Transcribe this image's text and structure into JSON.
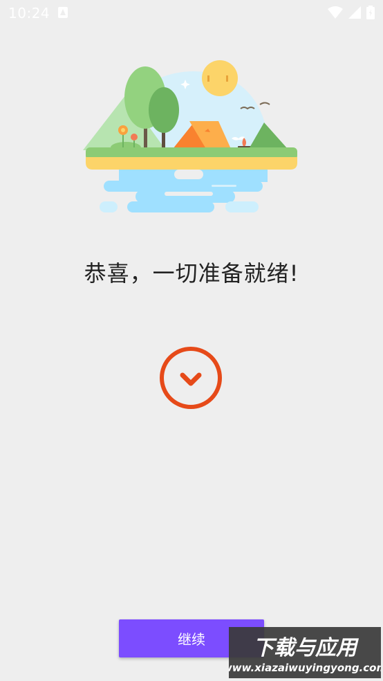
{
  "status_bar": {
    "time": "10:24"
  },
  "main": {
    "headline": "恭喜，一切准备就绪!",
    "continue_label": "继续"
  },
  "watermark": {
    "title": "下载与应用",
    "url": "www.xiazaiwuyingyong.com"
  },
  "colors": {
    "background": "#eeeeee",
    "accent": "#7c4dff",
    "check": "#e64a19"
  }
}
